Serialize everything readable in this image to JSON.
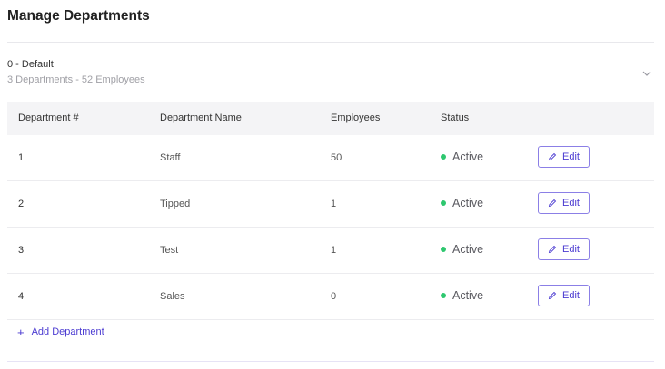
{
  "page": {
    "title": "Manage Departments"
  },
  "group": {
    "name": "0 - Default",
    "summary": "3 Departments - 52 Employees",
    "toggle_icon": "chevron-down-icon"
  },
  "table": {
    "headers": [
      "Department #",
      "Department Name",
      "Employees",
      "Status"
    ],
    "rows": [
      {
        "number": "1",
        "name": "Staff",
        "employees": "50",
        "status": "Active",
        "action": "Edit"
      },
      {
        "number": "2",
        "name": "Tipped",
        "employees": "1",
        "status": "Active",
        "action": "Edit"
      },
      {
        "number": "3",
        "name": "Test",
        "employees": "1",
        "status": "Active",
        "action": "Edit"
      },
      {
        "number": "4",
        "name": "Sales",
        "employees": "0",
        "status": "Active",
        "action": "Edit"
      }
    ]
  },
  "add_department": {
    "icon": "plus-icon",
    "label": "Add Department"
  },
  "colors": {
    "accent": "#4b3bd1",
    "status_active": "#2ec76f",
    "header_bg": "#f4f4f6"
  }
}
